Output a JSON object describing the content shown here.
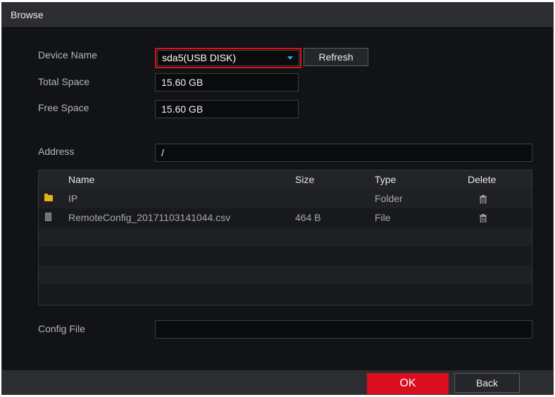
{
  "window": {
    "title": "Browse"
  },
  "form": {
    "device_name_label": "Device Name",
    "device_value": "sda5(USB DISK)",
    "refresh_label": "Refresh",
    "total_space_label": "Total Space",
    "total_space_value": "15.60 GB",
    "free_space_label": "Free Space",
    "free_space_value": "15.60 GB",
    "address_label": "Address",
    "address_value": "/",
    "config_file_label": "Config File",
    "config_file_value": ""
  },
  "table": {
    "columns": {
      "name": "Name",
      "size": "Size",
      "type": "Type",
      "delete": "Delete"
    },
    "rows": [
      {
        "icon": "folder-icon",
        "name": "IP",
        "size": "",
        "type": "Folder"
      },
      {
        "icon": "file-icon",
        "name": "RemoteConfig_20171103141044.csv",
        "size": "464 B",
        "type": "File"
      }
    ]
  },
  "footer": {
    "ok_label": "OK",
    "back_label": "Back"
  },
  "colors": {
    "accent": "#d90f20",
    "highlight_border": "#e0101b",
    "caret": "#29a8f0",
    "folder": "#e5b21d"
  }
}
